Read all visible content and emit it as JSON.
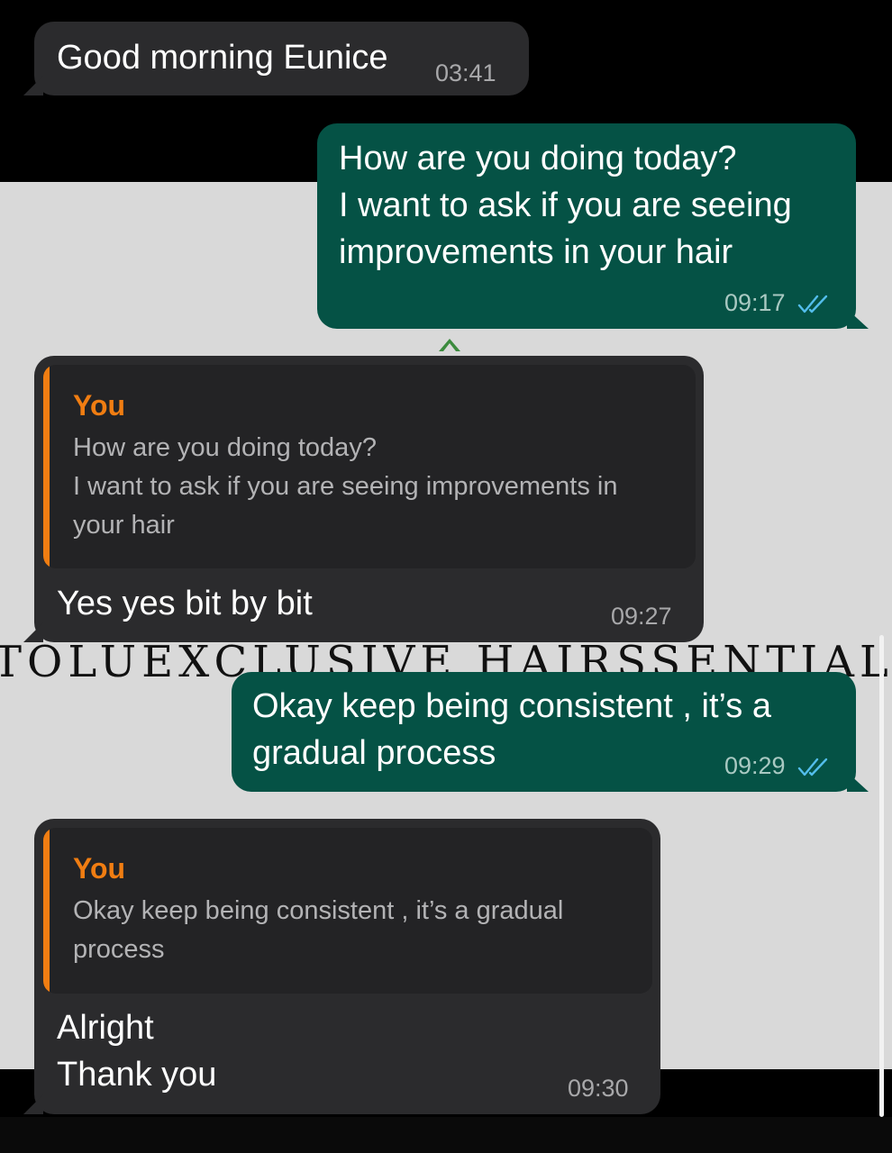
{
  "wallpaper": {
    "watermark_text": "TOLUEXCLUSIVE HAIRSSENTIAL"
  },
  "messages": [
    {
      "direction": "incoming",
      "text": "Good morning Eunice",
      "time": "03:41"
    },
    {
      "direction": "outgoing",
      "text": "How are you doing today?\nI want to ask if you are seeing\nimprovements in your hair",
      "time": "09:17",
      "status": "read"
    },
    {
      "direction": "incoming",
      "reply_to": {
        "author": "You",
        "text": "How are you doing today?\nI want to ask if you are seeing improvements in\nyour hair"
      },
      "text": "Yes yes bit by bit",
      "time": "09:27"
    },
    {
      "direction": "outgoing",
      "text": "Okay keep being consistent , it’s a\ngradual process",
      "time": "09:29",
      "status": "read"
    },
    {
      "direction": "incoming",
      "reply_to": {
        "author": "You",
        "text": "Okay keep being consistent , it’s a gradual\nprocess"
      },
      "text": "Alright\nThank you",
      "time": "09:30"
    }
  ],
  "colors": {
    "incoming_bubble": "#2b2b2d",
    "outgoing_bubble": "#055245",
    "quote_accent": "#f07d12",
    "read_ticks": "#53bdeb",
    "wallpaper": "#d9d9d9"
  },
  "icons": {
    "read_receipt": "double-check-icon"
  }
}
